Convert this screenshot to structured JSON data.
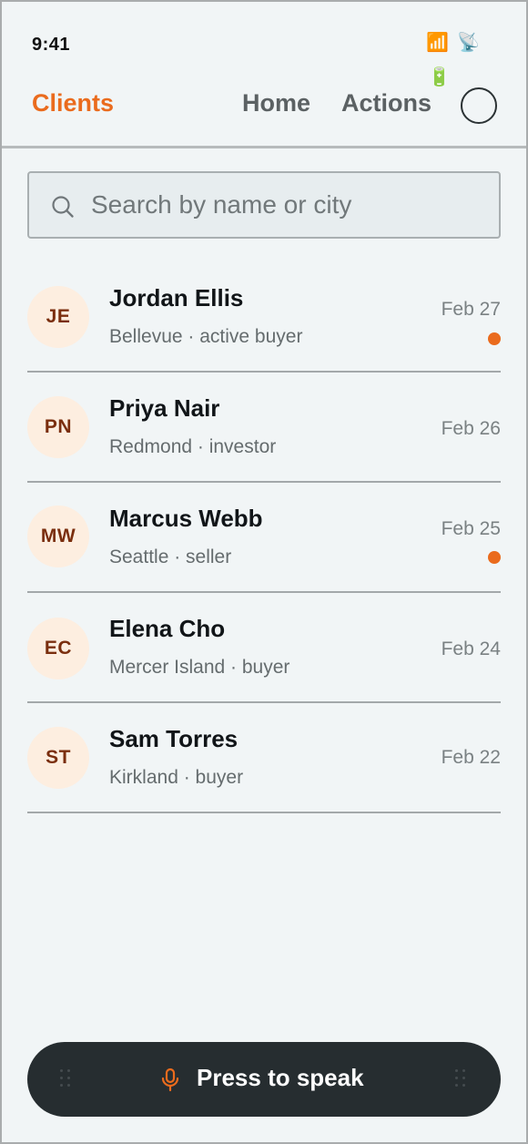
{
  "status_bar": {
    "time": "9:41",
    "icons": [
      "signal-icon",
      "satellite-icon",
      "battery-icon"
    ],
    "glyphs": [
      "📶",
      "📡",
      "🔋"
    ]
  },
  "header": {
    "title": "Clients",
    "nav": [
      "Home",
      "Actions"
    ]
  },
  "search": {
    "placeholder": "Search by name or city",
    "value": ""
  },
  "clients": [
    {
      "initials": "JE",
      "name": "Jordan Ellis",
      "subtitle": "Bellevue · active buyer",
      "date": "Feb 27",
      "unread": true
    },
    {
      "initials": "PN",
      "name": "Priya Nair",
      "subtitle": "Redmond · investor",
      "date": "Feb 26",
      "unread": false
    },
    {
      "initials": "MW",
      "name": "Marcus Webb",
      "subtitle": "Seattle · seller",
      "date": "Feb 25",
      "unread": true
    },
    {
      "initials": "EC",
      "name": "Elena Cho",
      "subtitle": "Mercer Island · buyer",
      "date": "Feb 24",
      "unread": false
    },
    {
      "initials": "ST",
      "name": "Sam Torres",
      "subtitle": "Kirkland · buyer",
      "date": "Feb 22",
      "unread": false
    }
  ],
  "speak_bar": {
    "label": "Press to speak",
    "icon": "microphone-icon"
  },
  "colors": {
    "accent": "#ea6b1d",
    "background": "#f1f5f6",
    "speak_bar": "#262d30",
    "avatar_bg": "#fdeee0",
    "avatar_text": "#7a2e0e"
  }
}
